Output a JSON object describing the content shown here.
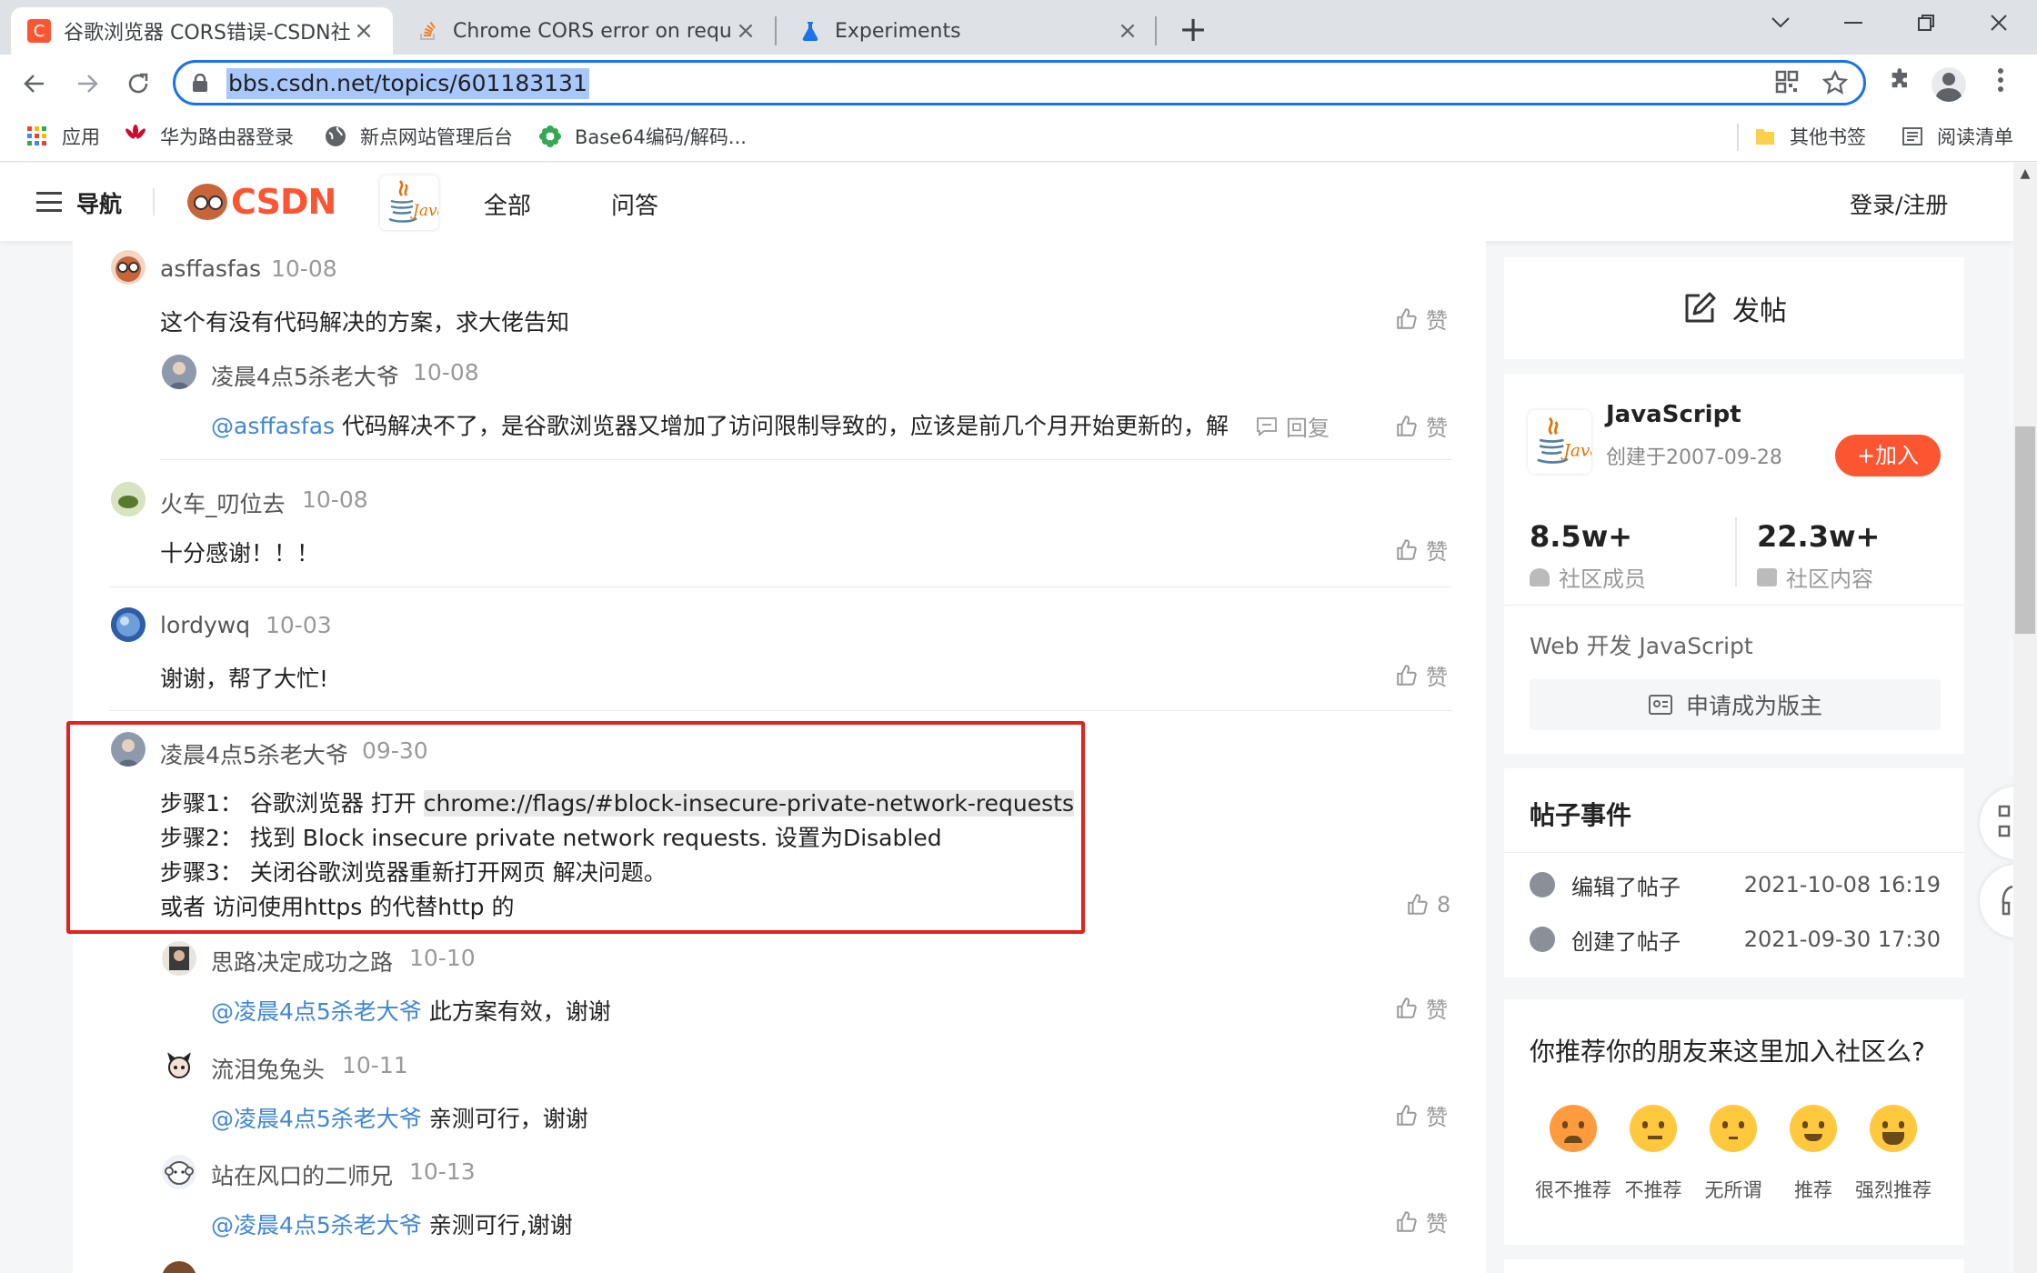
{
  "browser": {
    "tabs": [
      {
        "title": "谷歌浏览器 CORS错误-CSDN社区",
        "favicon_letter": "C"
      },
      {
        "title": "Chrome CORS error on request"
      },
      {
        "title": "Experiments"
      }
    ],
    "url": "bbs.csdn.net/topics/601183131",
    "bookmarks": [
      "应用",
      "华为路由器登录",
      "新点网站管理后台",
      "Base64编码/解码...",
      "其他书签",
      "阅读清单"
    ]
  },
  "header": {
    "nav_label": "导航",
    "logo_text": "CSDN",
    "links": [
      "全部",
      "问答"
    ],
    "login": "登录/注册"
  },
  "comments": [
    {
      "user": "asffasfas",
      "date": "10-08",
      "text": "这个有没有代码解决的方案，求大佬告知",
      "like": "赞"
    },
    {
      "user": "凌晨4点5杀老大爷",
      "date": "10-08",
      "mention": "@asffasfas",
      "text": " 代码解决不了，是谷歌浏览器又增加了访问限制导致的，应该是前几个月开始更新的，解",
      "reply": "回复",
      "like": "赞"
    },
    {
      "user": "火车_叨位去",
      "date": "10-08",
      "text": "十分感谢！！！",
      "like": "赞"
    },
    {
      "user": "lordywq",
      "date": "10-03",
      "text": "谢谢，帮了大忙!",
      "like": "赞"
    },
    {
      "user": "凌晨4点5杀老大爷",
      "date": "09-30",
      "step1_prefix": "步骤1： 谷歌浏览器 打开 ",
      "step1_link": "chrome://flags/#block-insecure-private-network-requests",
      "step2": "步骤2： 找到 Block insecure private network requests. 设置为Disabled",
      "step3": "步骤3： 关闭谷歌浏览器重新打开网页 解决问题。",
      "step4": "或者 访问使用https 的代替http 的",
      "like": "8"
    },
    {
      "user": "思路决定成功之路",
      "date": "10-10",
      "mention": "@凌晨4点5杀老大爷",
      "text": " 此方案有效，谢谢",
      "like": "赞"
    },
    {
      "user": "流泪兔兔头",
      "date": "10-11",
      "mention": "@凌晨4点5杀老大爷",
      "text": " 亲测可行，谢谢",
      "like": "赞"
    },
    {
      "user": "站在风口的二师兄",
      "date": "10-13",
      "mention": "@凌晨4点5杀老大爷",
      "text": " 亲测可行,谢谢",
      "like": "赞"
    }
  ],
  "sidebar": {
    "post_button": "发帖",
    "community": {
      "name": "JavaScript",
      "created": "创建于2007-09-28",
      "join": "+加入",
      "members_value": "8.5w+",
      "members_label": "社区成员",
      "content_value": "22.3w+",
      "content_label": "社区内容",
      "tags": "Web 开发 JavaScript",
      "apply": "申请成为版主"
    },
    "events": {
      "title": "帖子事件",
      "items": [
        {
          "action": "编辑了帖子",
          "time": "2021-10-08 16:19"
        },
        {
          "action": "创建了帖子",
          "time": "2021-09-30 17:30"
        }
      ]
    },
    "recommend": {
      "question": "你推荐你的朋友来这里加入社区么?",
      "options": [
        "很不推荐",
        "不推荐",
        "无所谓",
        "推荐",
        "强烈推荐"
      ]
    }
  },
  "colors": {
    "brand": "#fc5531",
    "mention": "#3f86d7",
    "highlight_box": "#e3211e",
    "chrome_blue": "#1a73e8"
  }
}
